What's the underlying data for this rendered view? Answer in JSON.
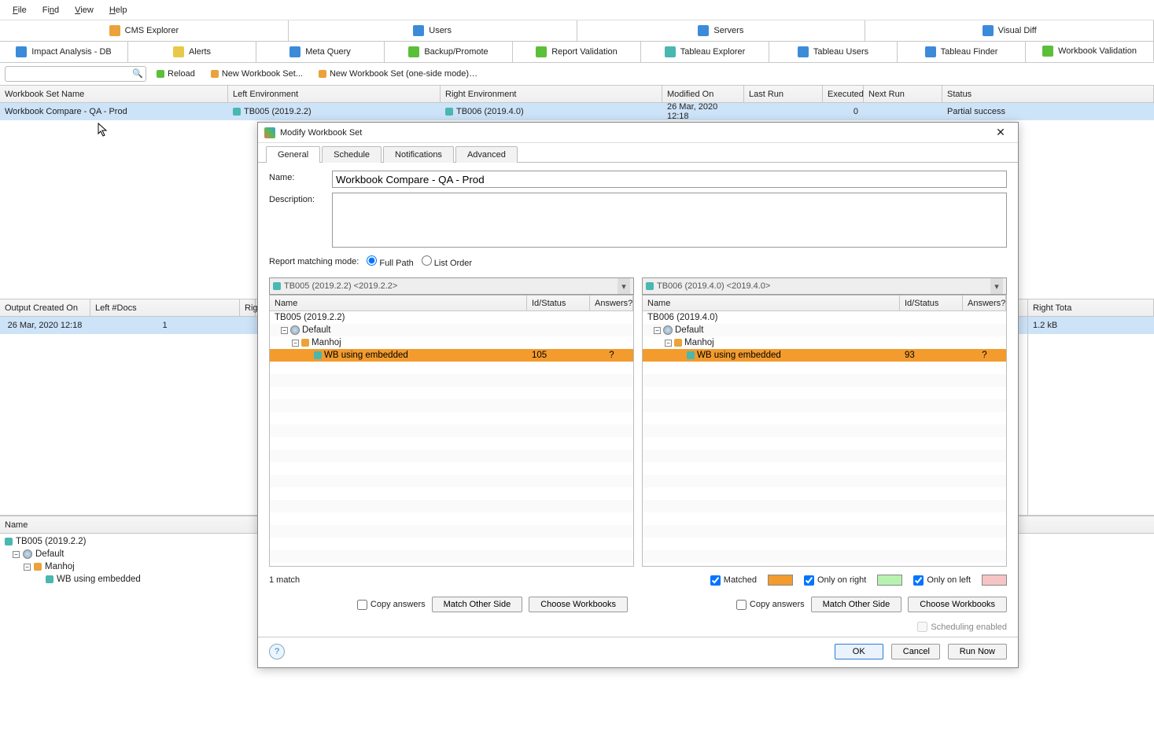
{
  "menu": {
    "file": "File",
    "find": "Find",
    "view": "View",
    "help": "Help"
  },
  "topTabs1": {
    "cms": "CMS Explorer",
    "users": "Users",
    "servers": "Servers",
    "visual": "Visual Diff"
  },
  "topTabs2": {
    "impact": "Impact Analysis - DB",
    "alerts": "Alerts",
    "meta": "Meta Query",
    "backup": "Backup/Promote",
    "reportval": "Report Validation",
    "tabex": "Tableau Explorer",
    "tabusers": "Tableau Users",
    "tabfinder": "Tableau Finder",
    "wbval": "Workbook Validation"
  },
  "toolbar": {
    "search_placeholder": "",
    "reload": "Reload",
    "newset": "New Workbook Set...",
    "newset1": "New Workbook Set (one-side mode)…"
  },
  "mainGrid": {
    "headers": {
      "name": "Workbook Set Name",
      "left": "Left Environment",
      "right": "Right Environment",
      "modified": "Modified On",
      "lastrun": "Last Run",
      "executed": "Executed",
      "nextrun": "Next Run",
      "status": "Status"
    },
    "row": {
      "name": "Workbook Compare - QA - Prod",
      "left": "TB005 (2019.2.2)",
      "right": "TB006 (2019.4.0)",
      "modified": "26 Mar, 2020  12:18",
      "lastrun": "",
      "executed": "0",
      "nextrun": "",
      "status": "Partial success"
    }
  },
  "midGrid": {
    "headers": {
      "output": "Output Created On",
      "leftdocs": "Left #Docs",
      "right": "Rig"
    },
    "row": {
      "output": "26 Mar, 2020  12:18",
      "leftdocs": "1"
    }
  },
  "rightStrip": {
    "righttotal": "Right Tota",
    "size": "1.2 kB"
  },
  "leftTree": {
    "header": "Name",
    "root": "TB005 (2019.2.2)",
    "default": "Default",
    "manhoj": "Manhoj",
    "wb": "WB using embedded"
  },
  "dialog": {
    "title": "Modify Workbook Set",
    "tabs": {
      "general": "General",
      "schedule": "Schedule",
      "notifications": "Notifications",
      "advanced": "Advanced"
    },
    "nameLabel": "Name:",
    "nameValue": "Workbook Compare - QA - Prod",
    "descLabel": "Description:",
    "descValue": "",
    "matchLabel": "Report matching mode:",
    "fullpath": "Full Path",
    "listorder": "List Order",
    "leftCombo": "TB005 (2019.2.2) <2019.2.2>",
    "rightCombo": "TB006 (2019.4.0) <2019.4.0>",
    "colName": "Name",
    "colId": "Id/Status",
    "colAns": "Answers?",
    "leftRoot": "TB005 (2019.2.2)",
    "rightRoot": "TB006 (2019.4.0)",
    "default": "Default",
    "manhoj": "Manhoj",
    "wb": "WB using embedded",
    "leftId": "105",
    "rightId": "93",
    "ansQ": "?",
    "matchText": "1 match",
    "legend": {
      "matched": "Matched",
      "onlyright": "Only on right",
      "onlyleft": "Only on left"
    },
    "colors": {
      "matched": "#f39b2d",
      "onlyright": "#b7f2b0",
      "onlyleft": "#f6c4c4"
    },
    "copyans": "Copy answers",
    "matchother": "Match Other Side",
    "choose": "Choose Workbooks",
    "sched": "Scheduling enabled",
    "ok": "OK",
    "cancel": "Cancel",
    "runnow": "Run Now"
  }
}
